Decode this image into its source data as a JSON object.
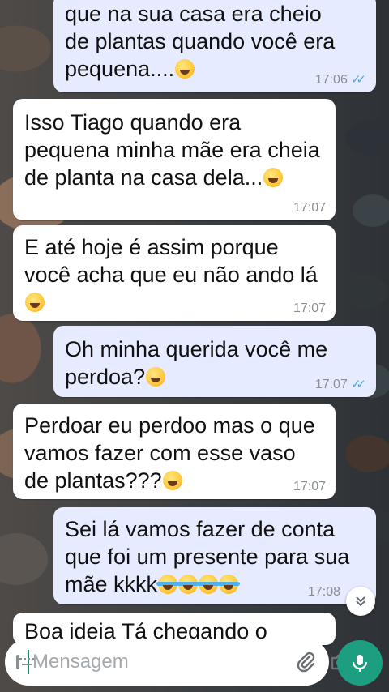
{
  "messages": [
    {
      "direction": "out",
      "lines": [
        "que na sua casa era cheio",
        "de plantas quando você era",
        "pequena...."
      ],
      "emojis": 1,
      "time": "17:06",
      "read": true
    },
    {
      "direction": "in",
      "lines": [
        "Isso Tiago quando era",
        "pequena minha mãe era cheia",
        "de planta na casa dela..."
      ],
      "emojis": 1,
      "time": "17:07"
    },
    {
      "direction": "in",
      "lines": [
        "E até hoje é assim porque",
        "você acha que eu não ando lá",
        ""
      ],
      "emojis": 1,
      "time": "17:07"
    },
    {
      "direction": "out",
      "lines": [
        "Oh minha querida você me",
        "perdoa?"
      ],
      "emojis": 1,
      "time": "17:07",
      "read": true
    },
    {
      "direction": "in",
      "lines": [
        "Perdoar eu perdoo mas o que",
        "vamos fazer com esse vaso",
        "de plantas???"
      ],
      "emojis": 1,
      "time": "17:07"
    },
    {
      "direction": "out",
      "lines": [
        "Sei lá vamos fazer de conta",
        "que foi um presente para sua",
        "mãe kkkk"
      ],
      "emojis": 4,
      "time": "17:08",
      "read": true
    },
    {
      "direction": "in",
      "lines": [
        "Boa ideia Tá chegando o"
      ],
      "emojis": 0,
      "time": ""
    }
  ],
  "composer": {
    "placeholder": "Mensagem",
    "value": ""
  },
  "icons": {
    "keyboard": "keyboard-icon",
    "attach": "paperclip-icon",
    "camera": "camera-icon",
    "mic": "microphone-icon",
    "scroll": "chevrons-down-icon"
  },
  "colors": {
    "outgoing_bubble": "#e7ebff",
    "incoming_bubble": "#ffffff",
    "read_ticks": "#53a6e8",
    "mic_button": "#1e9e80"
  }
}
